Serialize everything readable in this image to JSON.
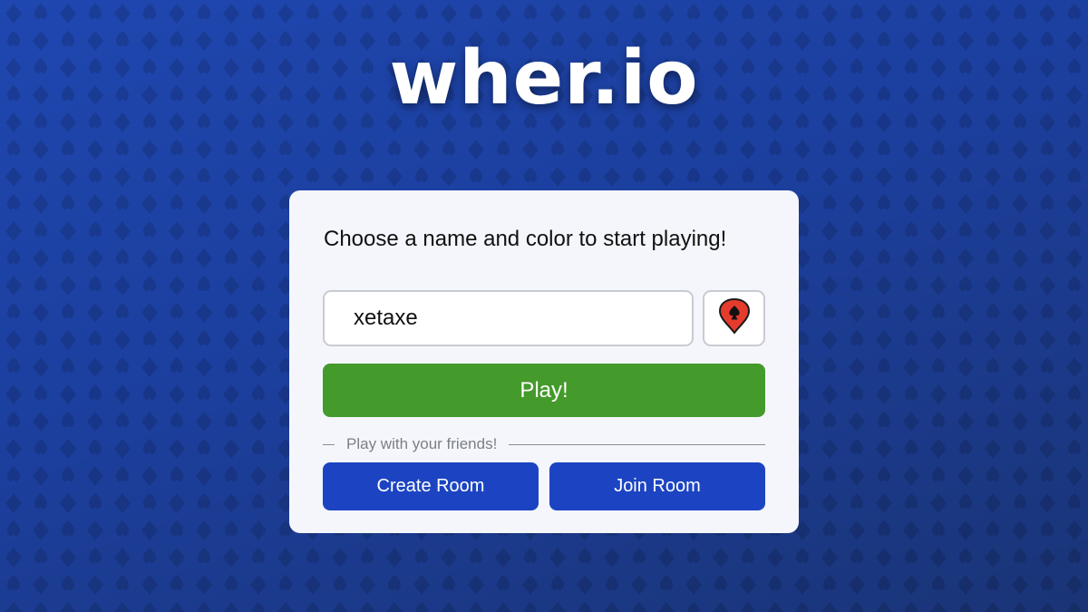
{
  "theme": {
    "background": "#1f47b0",
    "card_background": "#f4f6fb",
    "play_color": "#459a2c",
    "room_button_color": "#1c44c2",
    "pin_color": "#e53b2c"
  },
  "header": {
    "logo_text": "wher.io"
  },
  "card": {
    "prompt": "Choose a name and color to start playing!",
    "name_input": {
      "value": "xetaxe",
      "placeholder": ""
    },
    "color_picker": {
      "icon": "map-pin-icon"
    },
    "play_label": "Play!",
    "divider_text": "Play with your friends!",
    "create_room_label": "Create Room",
    "join_room_label": "Join Room"
  }
}
